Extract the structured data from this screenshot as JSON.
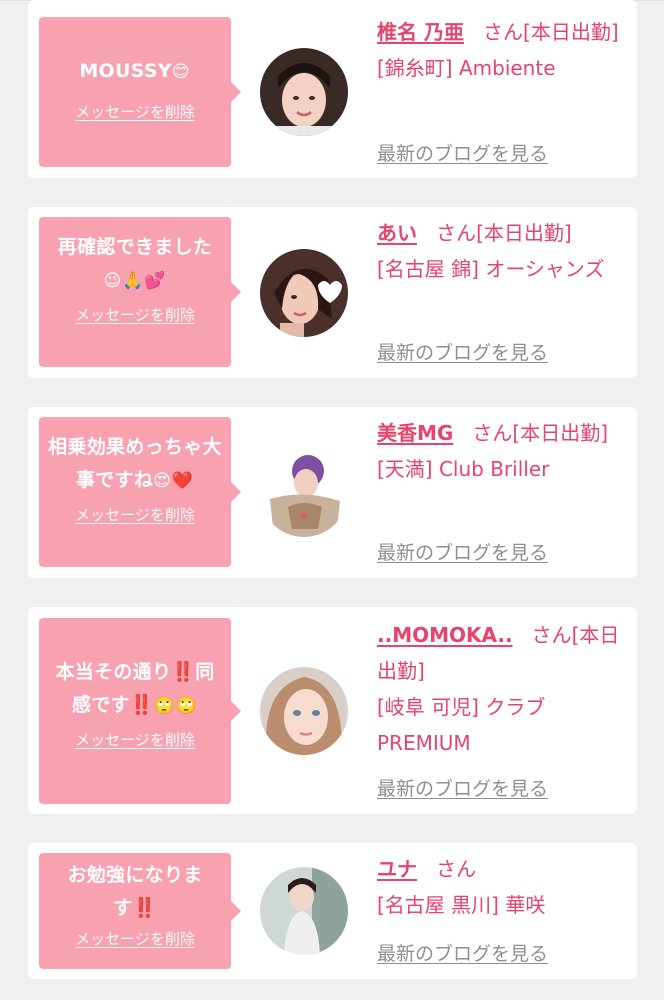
{
  "delete_label": "メッセージを削除",
  "blog_label": "最新のブログを見る",
  "colors": {
    "accent": "#e8436b",
    "bubble": "#f7a1b1",
    "background": "#f0f0f0",
    "link_gray": "#8f8f8f"
  },
  "items": [
    {
      "message": "MOUSSY",
      "emoji": "😊",
      "name": "椎名 乃亜",
      "suffix": "さん[本日出勤]",
      "location": "[錦糸町] Ambiente"
    },
    {
      "message": "再確認できました",
      "emoji": "😉🙏💕",
      "name": "あい",
      "suffix": "さん[本日出勤]",
      "location": "[名古屋 錦] オーシャンズ"
    },
    {
      "message": "相乗効果めっちゃ大事ですね",
      "emoji": "😍❤️",
      "name": "美香MG",
      "suffix": "さん[本日出勤]",
      "location": "[天満] Club Briller"
    },
    {
      "message": "本当その通り‼️同感です‼️",
      "emoji": "🙄🙄",
      "name": "..MOMOKA..",
      "suffix": "さん[本日出勤]",
      "location": "[岐阜 可児] クラブPREMIUM"
    },
    {
      "message": "お勉強になります‼️",
      "emoji": "",
      "name": "ユナ",
      "suffix": "さん",
      "location": "[名古屋 黒川] 華咲"
    }
  ]
}
